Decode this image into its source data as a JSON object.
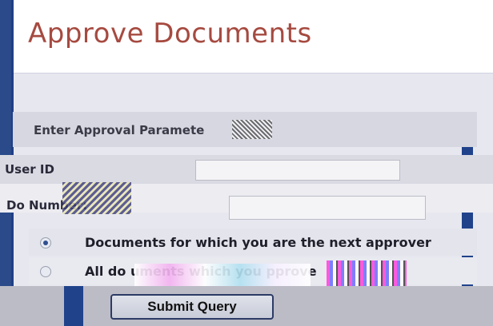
{
  "page": {
    "title": "Approve Documents"
  },
  "parameters_panel": {
    "heading": "Enter Approval Paramete"
  },
  "fields": {
    "user_id": {
      "label": "User ID",
      "value": ""
    },
    "document_number": {
      "label": "Do           Number:",
      "value": ""
    }
  },
  "radio_options": [
    {
      "label": "Documents for which you are the next approver",
      "selected": true
    },
    {
      "label": "All do       uments which you            pprove",
      "selected": false
    }
  ],
  "actions": {
    "submit_label": "Submit Query"
  },
  "colors": {
    "title": "#a64a40",
    "accent_blue": "#20428b",
    "panel": "#d6d7e0"
  }
}
